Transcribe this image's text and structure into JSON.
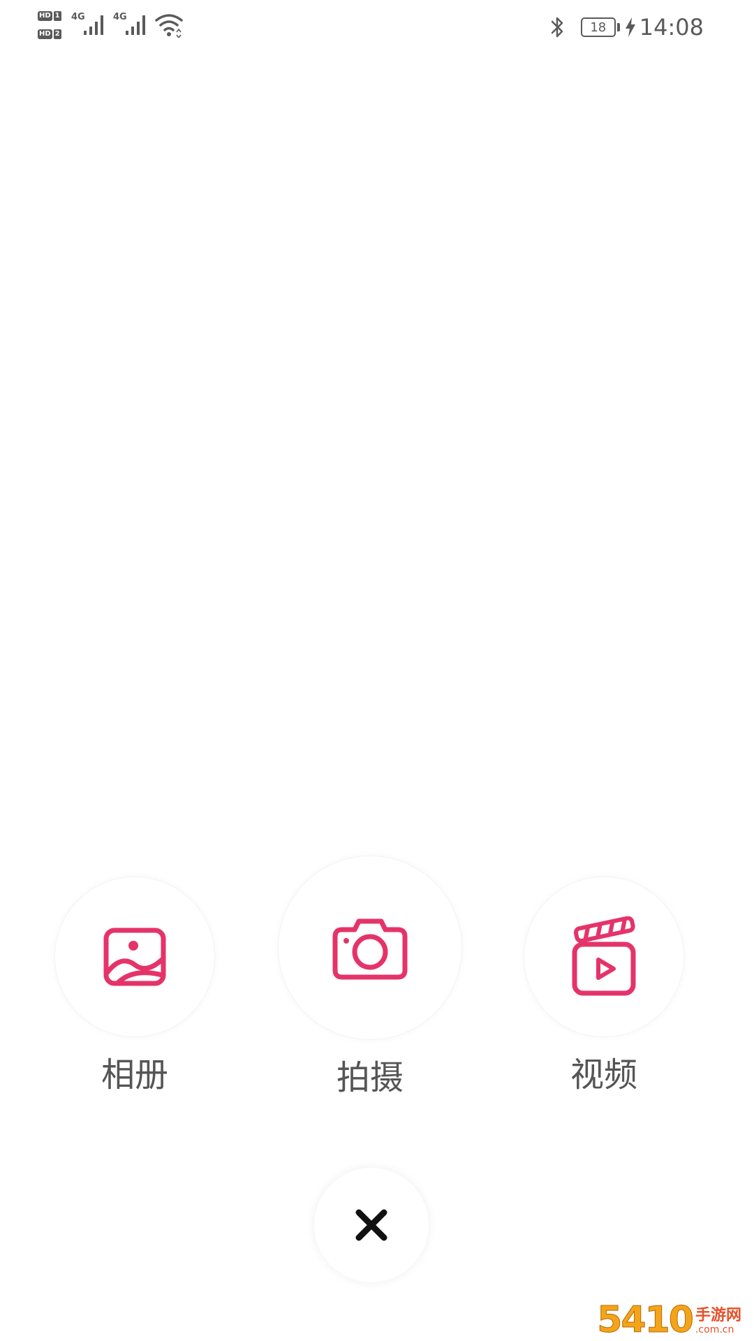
{
  "status_bar": {
    "sim1_label": "HD",
    "sim1_num": "1",
    "sim2_label": "HD",
    "sim2_num": "2",
    "signal1_tag": "4G",
    "signal2_tag": "4G",
    "battery_level": "18",
    "time": "14:08",
    "icons": [
      "hd-icon",
      "signal-icon",
      "wifi-icon",
      "bluetooth-icon",
      "battery-icon",
      "charging-icon"
    ]
  },
  "actions": {
    "album": {
      "label": "相册",
      "icon": "image-icon"
    },
    "shoot": {
      "label": "拍摄",
      "icon": "camera-icon"
    },
    "video": {
      "label": "视频",
      "icon": "video-clapper-icon"
    }
  },
  "close": {
    "icon": "close-icon"
  },
  "watermark": {
    "digits": "5410",
    "cn": "手游网",
    "domain": ".com.cn"
  },
  "colors": {
    "accent": "#E5336A",
    "text": "#555555",
    "background": "#FFFFFF",
    "watermark_orange": "#F5A41A",
    "watermark_red": "#E8502A"
  }
}
